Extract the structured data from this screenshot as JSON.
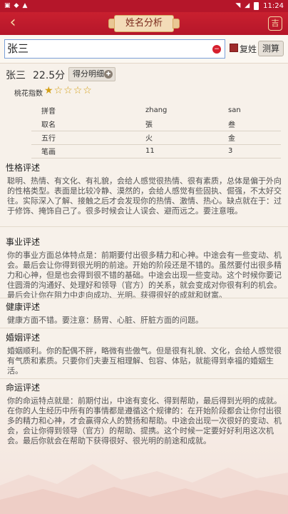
{
  "status_bar": {
    "time": "11:24"
  },
  "header": {
    "title": "姓名分析",
    "back_icon": "back-arrow-icon",
    "right_icon": "fortune-icon"
  },
  "search": {
    "value": "张三",
    "fuxing_label": "复姓",
    "calc_label": "测算",
    "fuxing_checked": true
  },
  "result": {
    "name": "张三",
    "score": "22.5分",
    "detail_label": "得分明细",
    "peach_label": "桃花指数",
    "peach_rating": 1,
    "peach_max": 5
  },
  "table": {
    "rows": [
      [
        "拼音",
        "zhang",
        "san"
      ],
      [
        "取名",
        "張",
        "叁"
      ],
      [
        "五行",
        "火",
        "金"
      ],
      [
        "笔画",
        "11",
        "3"
      ]
    ]
  },
  "sections": [
    {
      "title": "性格评述",
      "body": "聪明、热情、有文化、有礼貌，会给人感觉很热情、很有素质，总体是偏于外向的性格类型。表面是比较冷静、漠然的，会给人感觉有些固执、倔强，不太好交往。实际深入了解、接触之后才会发现你的热情、激情、热心。缺点就在于：过于修饰、掩饰自己了。很多时候会让人误会、避而远之。要注意哦。"
    },
    {
      "title": "事业评述",
      "body": "你的事业方面总体特点是：前期要付出很多精力和心神。中途会有一些变动、机会。最后会让你得到很光明的前途。开始的阶段还是不错的。虽然要付出很多精力和心神，但是也会得到很不错的基础。中途会出现一些变动。这个时候你要记住圆滑的沟通好、处理好和领导（官方）的关系，就会变成对你很有利的机会。最后会让你在阻力中走向成功、光明。获得很好的成就和财富。"
    },
    {
      "title": "健康评述",
      "body": "健康方面不错。要注意：肠胃、心脏、肝脏方面的问题。"
    },
    {
      "title": "婚姻评述",
      "body": "婚姻顺利。你的配偶不胖，略微有些傲气。但是很有礼貌、文化，会给人感觉很有气质和素质。只要你们夫妻互相理解、包容、体贴，就能得到幸福的婚姻生活。"
    },
    {
      "title": "命运评述",
      "body": "你的命运特点就是：前期付出，中途有变化、得到帮助，最后得到光明的成就。在你的人生经历中所有的事情都是遵循这个规律的：在开始阶段都会让你付出很多的精力和心神，才会赢得众人的赞扬和帮助。中途会出现一次很好的变动、机会，会让你得到领导（官方）的帮助、提携。这个时候一定要好好利用这次机会。最后你就会在帮助下获得很好、很光明的前途和成就。"
    }
  ],
  "colors": {
    "brand_red": "#b5162a",
    "gold": "#f6d9a8",
    "star": "#d4a017"
  }
}
